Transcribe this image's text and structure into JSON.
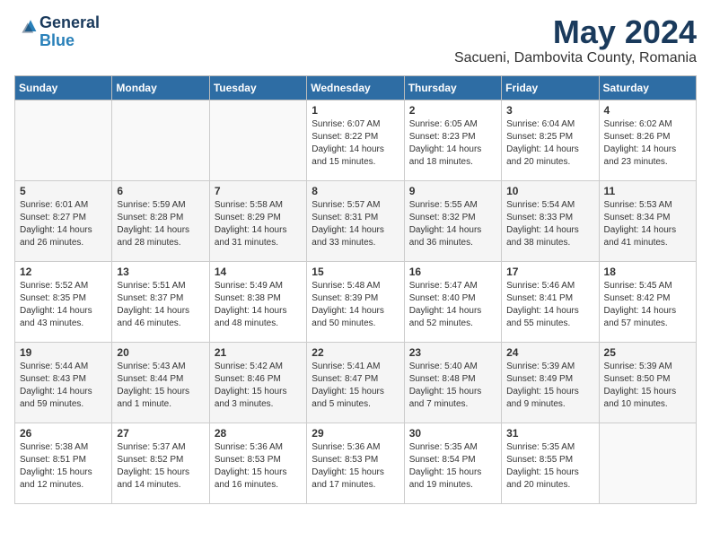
{
  "logo": {
    "line1": "General",
    "line2": "Blue"
  },
  "title": {
    "month_year": "May 2024",
    "location": "Sacueni, Dambovita County, Romania"
  },
  "headers": [
    "Sunday",
    "Monday",
    "Tuesday",
    "Wednesday",
    "Thursday",
    "Friday",
    "Saturday"
  ],
  "weeks": [
    [
      {
        "day": "",
        "content": ""
      },
      {
        "day": "",
        "content": ""
      },
      {
        "day": "",
        "content": ""
      },
      {
        "day": "1",
        "content": "Sunrise: 6:07 AM\nSunset: 8:22 PM\nDaylight: 14 hours\nand 15 minutes."
      },
      {
        "day": "2",
        "content": "Sunrise: 6:05 AM\nSunset: 8:23 PM\nDaylight: 14 hours\nand 18 minutes."
      },
      {
        "day": "3",
        "content": "Sunrise: 6:04 AM\nSunset: 8:25 PM\nDaylight: 14 hours\nand 20 minutes."
      },
      {
        "day": "4",
        "content": "Sunrise: 6:02 AM\nSunset: 8:26 PM\nDaylight: 14 hours\nand 23 minutes."
      }
    ],
    [
      {
        "day": "5",
        "content": "Sunrise: 6:01 AM\nSunset: 8:27 PM\nDaylight: 14 hours\nand 26 minutes."
      },
      {
        "day": "6",
        "content": "Sunrise: 5:59 AM\nSunset: 8:28 PM\nDaylight: 14 hours\nand 28 minutes."
      },
      {
        "day": "7",
        "content": "Sunrise: 5:58 AM\nSunset: 8:29 PM\nDaylight: 14 hours\nand 31 minutes."
      },
      {
        "day": "8",
        "content": "Sunrise: 5:57 AM\nSunset: 8:31 PM\nDaylight: 14 hours\nand 33 minutes."
      },
      {
        "day": "9",
        "content": "Sunrise: 5:55 AM\nSunset: 8:32 PM\nDaylight: 14 hours\nand 36 minutes."
      },
      {
        "day": "10",
        "content": "Sunrise: 5:54 AM\nSunset: 8:33 PM\nDaylight: 14 hours\nand 38 minutes."
      },
      {
        "day": "11",
        "content": "Sunrise: 5:53 AM\nSunset: 8:34 PM\nDaylight: 14 hours\nand 41 minutes."
      }
    ],
    [
      {
        "day": "12",
        "content": "Sunrise: 5:52 AM\nSunset: 8:35 PM\nDaylight: 14 hours\nand 43 minutes."
      },
      {
        "day": "13",
        "content": "Sunrise: 5:51 AM\nSunset: 8:37 PM\nDaylight: 14 hours\nand 46 minutes."
      },
      {
        "day": "14",
        "content": "Sunrise: 5:49 AM\nSunset: 8:38 PM\nDaylight: 14 hours\nand 48 minutes."
      },
      {
        "day": "15",
        "content": "Sunrise: 5:48 AM\nSunset: 8:39 PM\nDaylight: 14 hours\nand 50 minutes."
      },
      {
        "day": "16",
        "content": "Sunrise: 5:47 AM\nSunset: 8:40 PM\nDaylight: 14 hours\nand 52 minutes."
      },
      {
        "day": "17",
        "content": "Sunrise: 5:46 AM\nSunset: 8:41 PM\nDaylight: 14 hours\nand 55 minutes."
      },
      {
        "day": "18",
        "content": "Sunrise: 5:45 AM\nSunset: 8:42 PM\nDaylight: 14 hours\nand 57 minutes."
      }
    ],
    [
      {
        "day": "19",
        "content": "Sunrise: 5:44 AM\nSunset: 8:43 PM\nDaylight: 14 hours\nand 59 minutes."
      },
      {
        "day": "20",
        "content": "Sunrise: 5:43 AM\nSunset: 8:44 PM\nDaylight: 15 hours\nand 1 minute."
      },
      {
        "day": "21",
        "content": "Sunrise: 5:42 AM\nSunset: 8:46 PM\nDaylight: 15 hours\nand 3 minutes."
      },
      {
        "day": "22",
        "content": "Sunrise: 5:41 AM\nSunset: 8:47 PM\nDaylight: 15 hours\nand 5 minutes."
      },
      {
        "day": "23",
        "content": "Sunrise: 5:40 AM\nSunset: 8:48 PM\nDaylight: 15 hours\nand 7 minutes."
      },
      {
        "day": "24",
        "content": "Sunrise: 5:39 AM\nSunset: 8:49 PM\nDaylight: 15 hours\nand 9 minutes."
      },
      {
        "day": "25",
        "content": "Sunrise: 5:39 AM\nSunset: 8:50 PM\nDaylight: 15 hours\nand 10 minutes."
      }
    ],
    [
      {
        "day": "26",
        "content": "Sunrise: 5:38 AM\nSunset: 8:51 PM\nDaylight: 15 hours\nand 12 minutes."
      },
      {
        "day": "27",
        "content": "Sunrise: 5:37 AM\nSunset: 8:52 PM\nDaylight: 15 hours\nand 14 minutes."
      },
      {
        "day": "28",
        "content": "Sunrise: 5:36 AM\nSunset: 8:53 PM\nDaylight: 15 hours\nand 16 minutes."
      },
      {
        "day": "29",
        "content": "Sunrise: 5:36 AM\nSunset: 8:53 PM\nDaylight: 15 hours\nand 17 minutes."
      },
      {
        "day": "30",
        "content": "Sunrise: 5:35 AM\nSunset: 8:54 PM\nDaylight: 15 hours\nand 19 minutes."
      },
      {
        "day": "31",
        "content": "Sunrise: 5:35 AM\nSunset: 8:55 PM\nDaylight: 15 hours\nand 20 minutes."
      },
      {
        "day": "",
        "content": ""
      }
    ]
  ]
}
